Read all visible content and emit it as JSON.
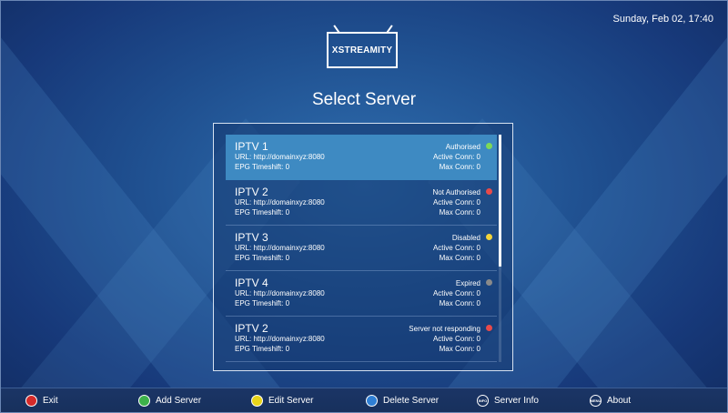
{
  "header": {
    "datetime": "Sunday, Feb 02, 17:40",
    "logo_text": "XSTREAMITY",
    "page_title": "Select Server"
  },
  "servers": [
    {
      "name": "IPTV 1",
      "url": "URL: http://domainxyz:8080",
      "epg": "EPG Timeshift: 0",
      "status": "Authorised",
      "status_color": "#7ed957",
      "active": "Active Conn:  0",
      "max": "Max Conn:  0",
      "selected": true
    },
    {
      "name": "IPTV 2",
      "url": "URL: http://domainxyz:8080",
      "epg": "EPG Timeshift: 0",
      "status": "Not Authorised",
      "status_color": "#e84a4a",
      "active": "Active Conn:  0",
      "max": "Max Conn:  0",
      "selected": false
    },
    {
      "name": "IPTV 3",
      "url": "URL: http://domainxyz:8080",
      "epg": "EPG Timeshift: 0",
      "status": "Disabled",
      "status_color": "#f2d43a",
      "active": "Active Conn:  0",
      "max": "Max Conn:  0",
      "selected": false
    },
    {
      "name": "IPTV 4",
      "url": "URL: http://domainxyz:8080",
      "epg": "EPG Timeshift: 0",
      "status": "Expired",
      "status_color": "#8a8a8a",
      "active": "Active Conn:  0",
      "max": "Max Conn:  0",
      "selected": false
    },
    {
      "name": "IPTV 2",
      "url": "URL: http://domainxyz:8080",
      "epg": "EPG Timeshift: 0",
      "status": "Server not responding",
      "status_color": "#e84a4a",
      "active": "Active Conn:  0",
      "max": "Max Conn:  0",
      "selected": false
    }
  ],
  "footer": {
    "exit": {
      "label": "Exit",
      "color": "#d42a2a"
    },
    "add": {
      "label": "Add Server",
      "color": "#3db24a"
    },
    "edit": {
      "label": "Edit Server",
      "color": "#e8d41a"
    },
    "delete": {
      "label": "Delete Server",
      "color": "#2f7fd4"
    },
    "info": {
      "label": "Server Info",
      "btn_text": "INFO"
    },
    "about": {
      "label": "About",
      "btn_text": "MENU"
    }
  }
}
